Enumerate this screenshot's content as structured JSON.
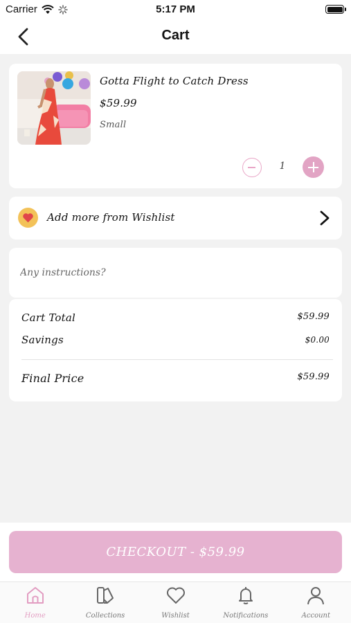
{
  "status_bar": {
    "carrier": "Carrier",
    "time": "5:17 PM"
  },
  "nav": {
    "title": "Cart"
  },
  "cart_item": {
    "name": "Gotta Flight to Catch Dress",
    "price": "$59.99",
    "size": "Small",
    "quantity": "1"
  },
  "wishlist": {
    "label": "Add more from Wishlist"
  },
  "instructions": {
    "placeholder": "Any instructions?"
  },
  "totals": {
    "cart_total_label": "Cart Total",
    "cart_total_value": "$59.99",
    "savings_label": "Savings",
    "savings_value": "$0.00",
    "final_label": "Final Price",
    "final_value": "$59.99"
  },
  "checkout": {
    "label": "CHECKOUT - $59.99"
  },
  "tabs": [
    {
      "label": "Home",
      "icon": "home-icon",
      "active": true
    },
    {
      "label": "Collections",
      "icon": "collections-icon",
      "active": false
    },
    {
      "label": "Wishlist",
      "icon": "heart-icon",
      "active": false
    },
    {
      "label": "Notifications",
      "icon": "bell-icon",
      "active": false
    },
    {
      "label": "Account",
      "icon": "user-icon",
      "active": false
    }
  ],
  "colors": {
    "accent_pink": "#e2a4c4",
    "checkout_pink": "#e6b2d0",
    "wishlist_badge": "#f3c259",
    "heart_red": "#e0454a"
  }
}
